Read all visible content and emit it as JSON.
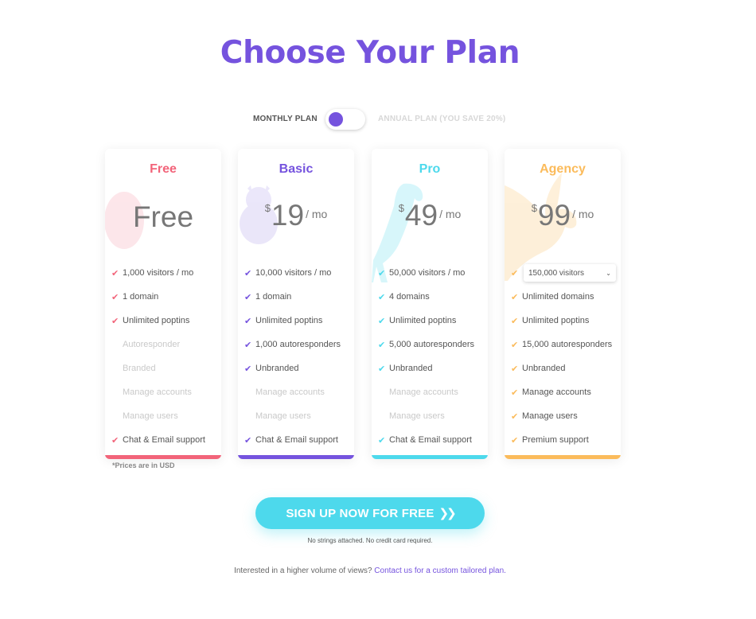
{
  "page": {
    "title": "Choose Your Plan"
  },
  "billing_toggle": {
    "monthly_label": "MONTHLY PLAN",
    "annual_label": "ANNUAL PLAN (YOU SAVE 20%)",
    "selected": "monthly"
  },
  "plans": [
    {
      "name": "Free",
      "accent": "#f2647a",
      "silhouette": "egg",
      "price_text": "Free",
      "currency": "",
      "amount": "",
      "period": "",
      "features": [
        {
          "text": "1,000 visitors / mo",
          "included": true
        },
        {
          "text": "1 domain",
          "included": true
        },
        {
          "text": "Unlimited poptins",
          "included": true
        },
        {
          "text": "Autoresponder",
          "included": false
        },
        {
          "text": "Branded",
          "included": false
        },
        {
          "text": "Manage accounts",
          "included": false
        },
        {
          "text": "Manage users",
          "included": false
        },
        {
          "text": "Chat & Email support",
          "included": true
        }
      ]
    },
    {
      "name": "Basic",
      "accent": "#7553de",
      "silhouette": "chick",
      "price_text": "",
      "currency": "$",
      "amount": "19",
      "period": "/ mo",
      "features": [
        {
          "text": "10,000 visitors / mo",
          "included": true
        },
        {
          "text": "1 domain",
          "included": true
        },
        {
          "text": "Unlimited poptins",
          "included": true
        },
        {
          "text": "1,000 autoresponders",
          "included": true
        },
        {
          "text": "Unbranded",
          "included": true
        },
        {
          "text": "Manage accounts",
          "included": false
        },
        {
          "text": "Manage users",
          "included": false
        },
        {
          "text": "Chat & Email support",
          "included": true
        }
      ]
    },
    {
      "name": "Pro",
      "accent": "#4dd9ec",
      "silhouette": "parrot",
      "price_text": "",
      "currency": "$",
      "amount": "49",
      "period": "/ mo",
      "features": [
        {
          "text": "50,000 visitors / mo",
          "included": true
        },
        {
          "text": "4 domains",
          "included": true
        },
        {
          "text": "Unlimited poptins",
          "included": true
        },
        {
          "text": "5,000 autoresponders",
          "included": true
        },
        {
          "text": "Unbranded",
          "included": true
        },
        {
          "text": "Manage accounts",
          "included": false
        },
        {
          "text": "Manage users",
          "included": false
        },
        {
          "text": "Chat & Email support",
          "included": true
        }
      ]
    },
    {
      "name": "Agency",
      "accent": "#fbbb5b",
      "silhouette": "eagle",
      "price_text": "",
      "currency": "$",
      "amount": "99",
      "period": "/ mo",
      "visitors_select": "150,000 visitors",
      "features": [
        {
          "text": "Unlimited domains",
          "included": true
        },
        {
          "text": "Unlimited poptins",
          "included": true
        },
        {
          "text": "15,000 autoresponders",
          "included": true
        },
        {
          "text": "Unbranded",
          "included": true
        },
        {
          "text": "Manage accounts",
          "included": true
        },
        {
          "text": "Manage users",
          "included": true
        },
        {
          "text": "Premium support",
          "included": true
        }
      ]
    }
  ],
  "prices_note": "*Prices are in USD",
  "cta": {
    "label": "SIGN UP NOW FOR FREE",
    "arrow_icon": "double-chevron-right-icon",
    "note": "No strings attached. No credit card required."
  },
  "footer": {
    "text": "Interested in a higher volume of views?",
    "link_text": "Contact us for a custom tailored plan."
  },
  "icons": {
    "check": "check-icon",
    "chevron": "chevron-down-icon"
  }
}
